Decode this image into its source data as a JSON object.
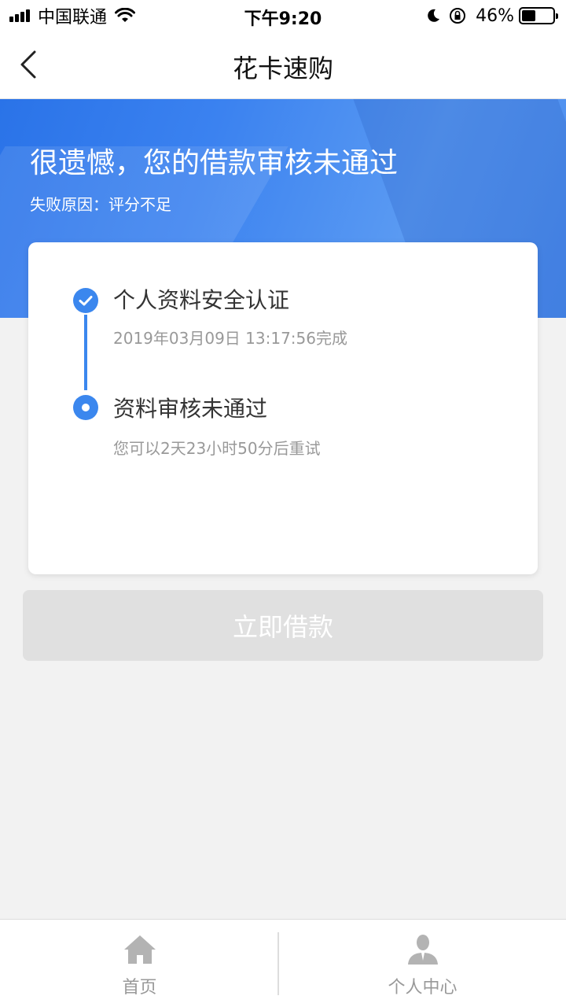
{
  "status_bar": {
    "carrier": "中国联通",
    "time": "下午9:20",
    "battery": "46%",
    "battery_level": 0.46
  },
  "nav": {
    "title": "花卡速购"
  },
  "hero": {
    "title": "很遗憾，您的借款审核未通过",
    "reason_label": "失败原因：",
    "reason_value": "评分不足"
  },
  "steps": [
    {
      "title": "个人资料安全认证",
      "subtitle": "2019年03月09日 13:17:56完成",
      "icon": "check-circle-icon"
    },
    {
      "title": "资料审核未通过",
      "subtitle": "您可以2天23小时50分后重试",
      "icon": "dot-circle-icon"
    }
  ],
  "loan_button": {
    "label": "立即借款"
  },
  "tabs": [
    {
      "label": "首页",
      "icon": "home-icon"
    },
    {
      "label": "个人中心",
      "icon": "user-icon"
    }
  ],
  "colors": {
    "accent": "#3b87ee",
    "hero": "#3b82f0",
    "button_disabled": "#e0e0e0",
    "tab_inactive": "#999999"
  }
}
